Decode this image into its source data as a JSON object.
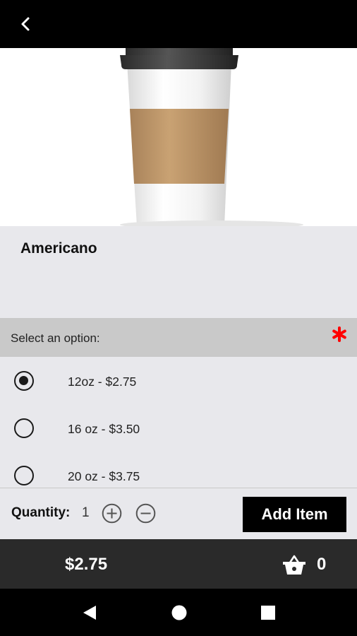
{
  "header": {
    "back_icon": "chevron-left-icon"
  },
  "product": {
    "name": "Americano",
    "image_icon": "coffee-cup-image"
  },
  "options": {
    "header_label": "Select an option:",
    "required_color": "#ff0000",
    "items": [
      {
        "label": "12oz - $2.75",
        "selected": true
      },
      {
        "label": "16 oz - $3.50",
        "selected": false
      },
      {
        "label": "20 oz - $3.75",
        "selected": false
      }
    ]
  },
  "quantity": {
    "label": "Quantity:",
    "value": "1",
    "add_label": "Add Item"
  },
  "cart": {
    "total": "$2.75",
    "count": "0"
  },
  "colors": {
    "accent": "#000000",
    "cart_bar": "#2a2a2a",
    "option_header": "#c9c9c9"
  }
}
